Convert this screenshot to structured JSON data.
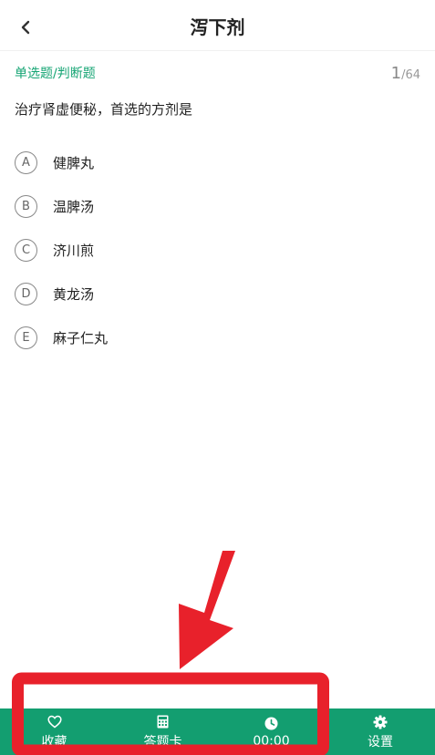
{
  "header": {
    "title": "泻下剂"
  },
  "question": {
    "type_label": "单选题/判断题",
    "current": "1",
    "total": "/64",
    "text": "治疗肾虚便秘，首选的方剂是",
    "options": [
      {
        "letter": "A",
        "text": "健脾丸"
      },
      {
        "letter": "B",
        "text": "温脾汤"
      },
      {
        "letter": "C",
        "text": "济川煎"
      },
      {
        "letter": "D",
        "text": "黄龙汤"
      },
      {
        "letter": "E",
        "text": "麻子仁丸"
      }
    ]
  },
  "bottom_bar": {
    "favorite": {
      "label": "收藏",
      "icon": "heart-icon"
    },
    "answer_card": {
      "label": "答题卡",
      "icon": "calculator-icon"
    },
    "timer": {
      "label": "00:00",
      "icon": "clock-icon"
    },
    "settings": {
      "label": "设置",
      "icon": "gear-icon"
    }
  },
  "colors": {
    "accent": "#139e70",
    "annotation": "#e8212b"
  }
}
